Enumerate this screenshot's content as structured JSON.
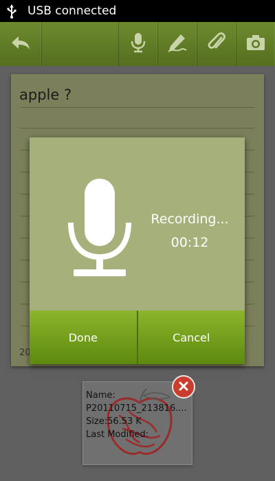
{
  "status_bar": {
    "text": "USB connected",
    "icon": "usb-icon"
  },
  "toolbar": {
    "icons": [
      "back-arrow-icon",
      "microphone-icon",
      "pen-icon",
      "paperclip-icon",
      "camera-icon"
    ]
  },
  "note": {
    "title": "apple ?",
    "date_fragment": "20"
  },
  "recording_dialog": {
    "status": "Recording...",
    "time": "00:12",
    "done_label": "Done",
    "cancel_label": "Cancel"
  },
  "attachment": {
    "name_label": "Name:",
    "file_name": "P20110715_213816....",
    "size": "Size:56.53 K",
    "modified_label": "Last Modified:"
  },
  "colors": {
    "toolbar": "#5f7a26",
    "dialog": "#a5b07a",
    "button_green": "#7aa51f",
    "remove_red": "#c83d2c"
  }
}
